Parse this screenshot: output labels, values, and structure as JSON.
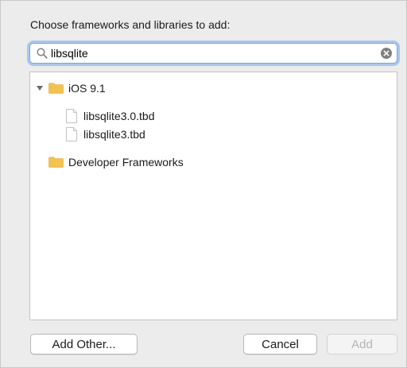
{
  "dialog": {
    "title": "Choose frameworks and libraries to add:"
  },
  "search": {
    "value": "libsqlite",
    "icon": "search-icon",
    "clear_icon": "clear-icon"
  },
  "tree": {
    "groups": [
      {
        "label": "iOS 9.1",
        "expanded": true,
        "children": [
          "libsqlite3.0.tbd",
          "libsqlite3.tbd"
        ]
      },
      {
        "label": "Developer Frameworks",
        "expanded": false,
        "children": []
      }
    ]
  },
  "buttons": {
    "add_other": "Add Other...",
    "cancel": "Cancel",
    "add": "Add"
  },
  "colors": {
    "folder": "#f3c350",
    "focus_ring": "#a9c7ee"
  }
}
